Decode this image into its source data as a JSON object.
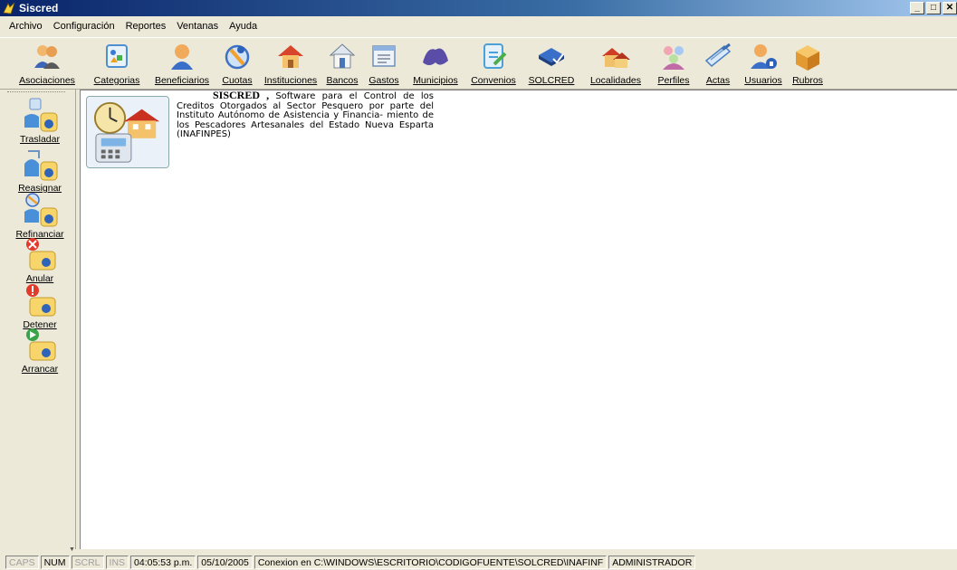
{
  "window": {
    "title": "Siscred",
    "minimize": "_",
    "restore": "□",
    "close": "✕"
  },
  "menu": [
    {
      "label": "Archivo",
      "accel": "A",
      "rest": "rchivo"
    },
    {
      "label": "Configuración",
      "accel": "C",
      "rest": "onfiguración"
    },
    {
      "label": "Reportes",
      "accel": "R",
      "rest": "eportes"
    },
    {
      "label": "Ventanas",
      "accel": "V",
      "rest": "entanas"
    },
    {
      "label": "Ayuda",
      "accel": "",
      "rest": "Ayuda"
    }
  ],
  "toolbar": [
    {
      "label": "Asociaciones",
      "icon": "users-icon"
    },
    {
      "label": "Categorias",
      "icon": "categories-icon"
    },
    {
      "label": "Beneficiarios",
      "icon": "person-icon"
    },
    {
      "label": "Cuotas",
      "icon": "quota-icon"
    },
    {
      "label": "Instituciones",
      "icon": "house-icon"
    },
    {
      "label": "Bancos",
      "icon": "bank-icon"
    },
    {
      "label": "Gastos",
      "icon": "expenses-icon"
    },
    {
      "label": "Municipios",
      "icon": "map-icon"
    },
    {
      "label": "Convenios",
      "icon": "document-icon"
    },
    {
      "label": "SOLCRED",
      "icon": "book-icon"
    },
    {
      "label": "Localidades",
      "icon": "houses-icon"
    },
    {
      "label": "Perfiles",
      "icon": "profiles-icon"
    },
    {
      "label": "Actas",
      "icon": "notes-icon"
    },
    {
      "label": "Usuarios",
      "icon": "user-lock-icon"
    },
    {
      "label": "Rubros",
      "icon": "box-icon"
    }
  ],
  "sidebar": [
    {
      "label": "Trasladar",
      "icon": "transfer-icon"
    },
    {
      "label": "Reasignar",
      "icon": "reassign-icon"
    },
    {
      "label": "Refinanciar",
      "icon": "refinance-icon"
    },
    {
      "label": "Anular",
      "icon": "cancel-icon"
    },
    {
      "label": "Detener",
      "icon": "stop-icon"
    },
    {
      "label": "Arrancar",
      "icon": "start-icon"
    }
  ],
  "banner": {
    "brand": "SISCRED ,",
    "text": "Software para el Control de los Creditos Otorgados al Sector Pesquero por parte del Instituto Autónomo de Asistencia y Financia- miento de los Pescadores Artesanales del Estado Nueva Esparta (INAFINPES)"
  },
  "status": {
    "caps": "CAPS",
    "num": "NUM",
    "scrl": "SCRL",
    "ins": "INS",
    "time": "04:05:53 p.m.",
    "date": "05/10/2005",
    "connection": "Conexion en C:\\WINDOWS\\ESCRITORIO\\CODIGOFUENTE\\SOLCRED\\INAFINF",
    "user": "ADMINISTRADOR"
  }
}
